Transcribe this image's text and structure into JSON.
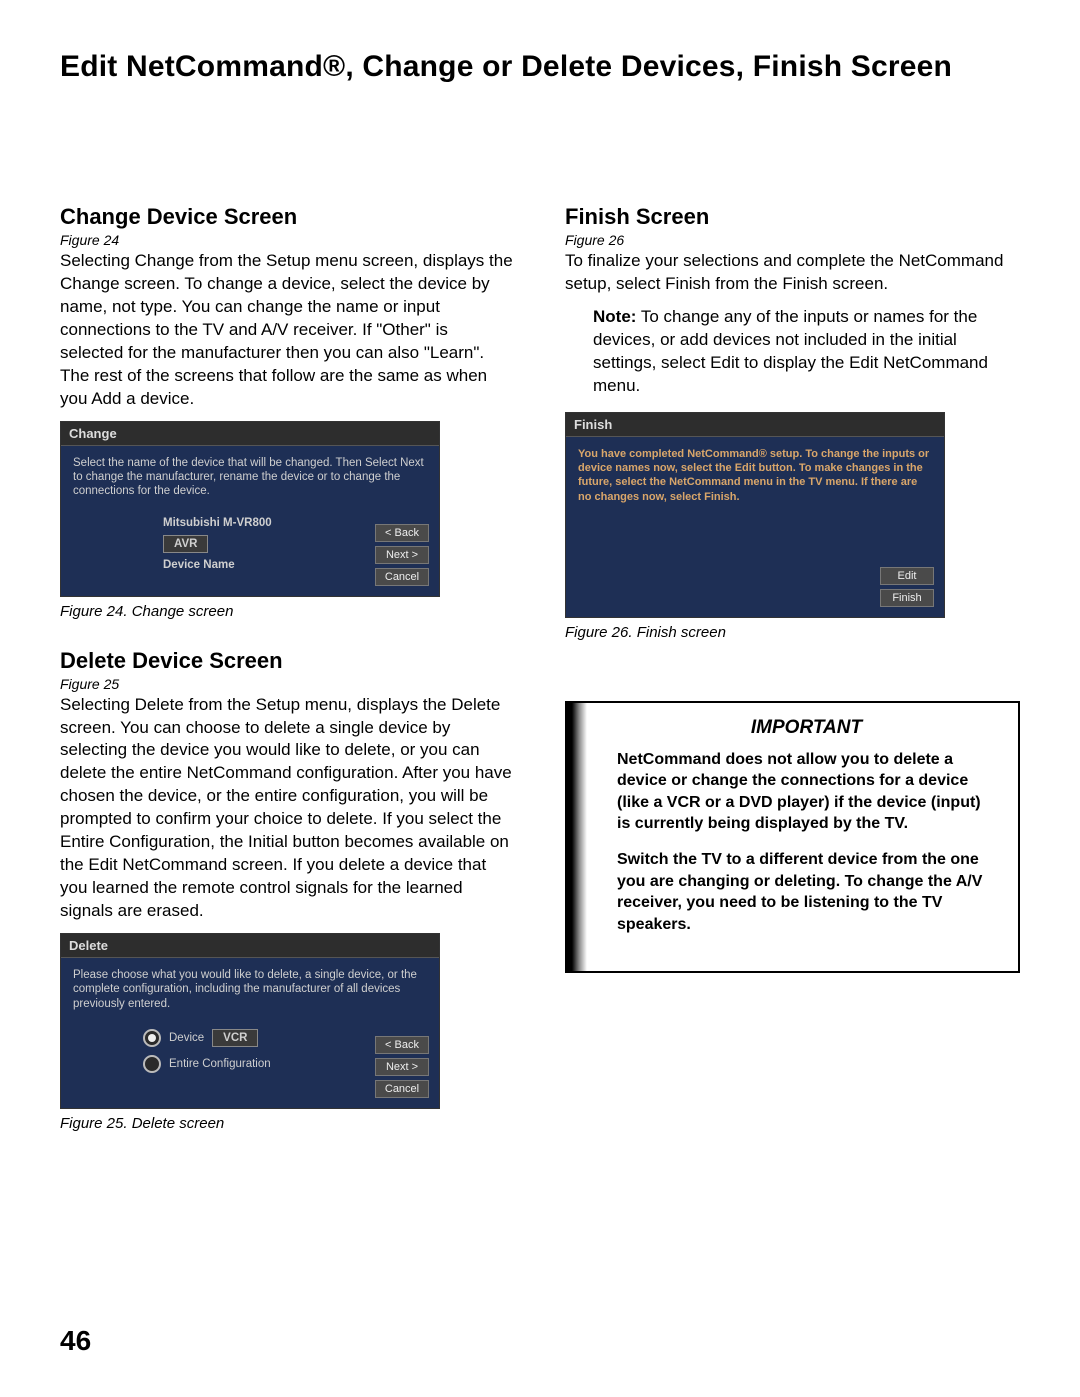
{
  "title": "Edit NetCommand®, Change or Delete Devices, Finish Screen",
  "pageNumber": "46",
  "left": {
    "changeHeading": "Change Device Screen",
    "changeFigRef": "Figure 24",
    "changeBody": "Selecting Change from the Setup menu screen, displays the Change screen. To change a device, select the device by name, not type.  You can change the name or input connections to the TV and A/V receiver.  If \"Other\" is selected for the manufacturer then you can also \"Learn\".  The rest of the screens that follow are the same as when you Add a device.",
    "fig24": {
      "winTitle": "Change",
      "desc": "Select the name of the device that will be changed.  Then Select Next to change the manufacturer, rename the device or to change the connections for the device.",
      "mname": "Mitsubishi M-VR800",
      "avr": "AVR",
      "devLabel": "Device Name",
      "back": "< Back",
      "next": "Next >",
      "cancel": "Cancel"
    },
    "fig24Caption": "Figure 24. Change screen",
    "deleteHeading": "Delete Device Screen",
    "deleteFigRef": "Figure 25",
    "deleteBody": "Selecting Delete from the Setup menu, displays the Delete screen.  You can choose to delete a single device by selecting the device you would like to delete, or you can delete the entire NetCommand configuration.  After you have chosen the device, or the entire configuration, you will be prompted to confirm your choice to delete.  If you select the Entire Configuration, the Initial button becomes available on the Edit NetCommand screen.  If you delete a device that you learned the remote control signals for the learned signals are erased.",
    "fig25": {
      "winTitle": "Delete",
      "desc": "Please choose what you would like to delete, a single device, or the complete configuration, including the manufacturer of all devices previously entered.",
      "deviceLabel": "Device",
      "vcr": "VCR",
      "entire": "Entire Configuration",
      "back": "< Back",
      "next": "Next >",
      "cancel": "Cancel"
    },
    "fig25Caption": "Figure 25. Delete screen"
  },
  "right": {
    "finishHeading": "Finish Screen",
    "finishFigRef": "Figure 26",
    "finishBody": "To finalize your selections and complete the NetCommand setup, select Finish from the Finish screen.",
    "noteLabel": "Note:",
    "noteText": "  To change any of the inputs or names for the devices, or add devices not included in the initial settings, select Edit to display the Edit NetCommand menu.",
    "fig26": {
      "winTitle": "Finish",
      "desc": "You have completed NetCommand® setup.  To change the inputs or device names now, select the Edit button.  To make changes in the future, select the NetCommand menu in the TV menu.  If there are no changes now, select Finish.",
      "edit": "Edit",
      "finish": "Finish"
    },
    "fig26Caption": "Figure 26. Finish screen",
    "importantTitle": "IMPORTANT",
    "importantP1": "NetCommand does not allow you to delete a device or change the connections for a device (like a VCR or a DVD player) if the device (input) is currently being displayed by the TV.",
    "importantP2": "Switch the TV to a different device from the one you are changing or deleting.  To change the A/V receiver, you need to be listening to the TV speakers."
  }
}
